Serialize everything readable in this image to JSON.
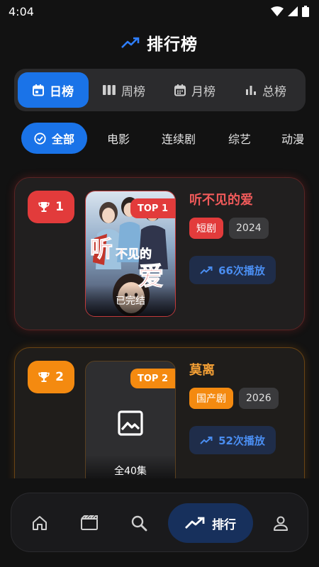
{
  "status_bar": {
    "time": "4:04"
  },
  "header": {
    "title": "排行榜",
    "icon": "trending-up-icon"
  },
  "period_tabs": [
    {
      "label": "日榜",
      "icon": "calendar-day-icon",
      "active": true
    },
    {
      "label": "周榜",
      "icon": "week-bars-icon",
      "active": false
    },
    {
      "label": "月榜",
      "icon": "calendar-month-icon",
      "active": false
    },
    {
      "label": "总榜",
      "icon": "bar-chart-icon",
      "active": false
    }
  ],
  "categories": [
    {
      "label": "全部",
      "icon": "check-circle-icon",
      "active": true
    },
    {
      "label": "电影",
      "active": false
    },
    {
      "label": "连续剧",
      "active": false
    },
    {
      "label": "综艺",
      "active": false
    },
    {
      "label": "动漫",
      "active": false
    }
  ],
  "rankings": [
    {
      "rank": "1",
      "top_label": "TOP 1",
      "title": "听不见的爱",
      "genre": "短剧",
      "year": "2024",
      "plays": "66次播放",
      "poster_caption": "已完结",
      "accent": "#e23b3b"
    },
    {
      "rank": "2",
      "top_label": "TOP 2",
      "title": "莫离",
      "genre": "国产剧",
      "year": "2026",
      "plays": "52次播放",
      "poster_caption": "全40集",
      "accent": "#f48a10"
    }
  ],
  "bottom_nav": [
    {
      "icon": "home-icon",
      "active": false
    },
    {
      "icon": "clapperboard-icon",
      "active": false
    },
    {
      "icon": "search-icon",
      "active": false
    },
    {
      "label": "排行",
      "icon": "trending-up-icon",
      "active": true
    },
    {
      "icon": "profile-icon",
      "active": false
    }
  ],
  "colors": {
    "accent_blue": "#1a73e8",
    "rank_1": "#e23b3b",
    "rank_2": "#f48a10",
    "background": "#121212"
  }
}
